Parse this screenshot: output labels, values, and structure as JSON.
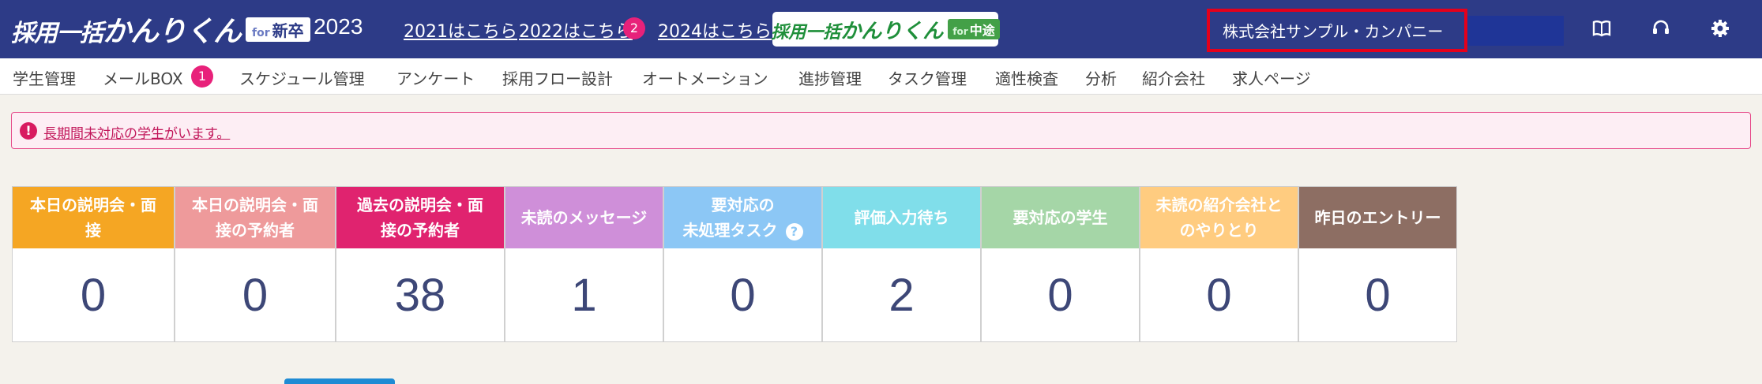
{
  "header": {
    "logo_main_prefix": "採用一括",
    "logo_main_big": "かんりくん",
    "logo_for": "for",
    "logo_tag": "新卒",
    "year_title": "- 2023",
    "links": [
      {
        "label": "2021はこちら"
      },
      {
        "label": "2022はこちら",
        "badge": "2"
      },
      {
        "label": "2024はこちら"
      }
    ],
    "chuto": {
      "prefix": "採用一括",
      "big": "かんりくん",
      "for": "for",
      "tag": "中途"
    },
    "company": "株式会社サンプル・カンパニー",
    "icons": [
      "book-icon",
      "headset-icon",
      "gear-icon"
    ]
  },
  "nav": {
    "items": [
      {
        "label": "学生管理"
      },
      {
        "label": "メールBOX",
        "badge": "1"
      },
      {
        "label": "スケジュール管理"
      },
      {
        "label": "アンケート"
      },
      {
        "label": "採用フロー設計"
      },
      {
        "label": "オートメーション"
      },
      {
        "label": "進捗管理"
      },
      {
        "label": "タスク管理"
      },
      {
        "label": "適性検査"
      },
      {
        "label": "分析"
      },
      {
        "label": "紹介会社"
      },
      {
        "label": "求人ページ"
      }
    ]
  },
  "alert": {
    "text": "長期間未対応の学生がいます。"
  },
  "stats": [
    {
      "line1": "本日の説明会・面",
      "line2": "接",
      "value": "0",
      "color": "#f5a623"
    },
    {
      "line1": "本日の説明会・面",
      "line2": "接の予約者",
      "value": "0",
      "color": "#ee9a9b"
    },
    {
      "line1": "過去の説明会・面",
      "line2": "接の予約者",
      "value": "38",
      "color": "#e0236f"
    },
    {
      "line1": "未読のメッセージ",
      "line2": "",
      "value": "1",
      "color": "#cf8fd9"
    },
    {
      "line1": "要対応の",
      "line2": "未処理タスク",
      "value": "0",
      "color": "#8cc7f5"
    },
    {
      "line1": "評価入力待ち",
      "line2": "",
      "value": "2",
      "color": "#80deea"
    },
    {
      "line1": "要対応の学生",
      "line2": "",
      "value": "0",
      "color": "#a5d6a7"
    },
    {
      "line1": "未読の紹介会社と",
      "line2": "のやりとり",
      "value": "0",
      "color": "#ffcc80"
    },
    {
      "line1": "昨日のエントリー",
      "line2": "",
      "value": "0",
      "color": "#8d6e63"
    }
  ]
}
